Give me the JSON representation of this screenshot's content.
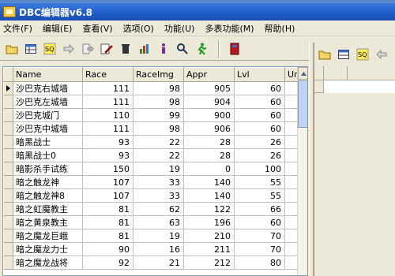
{
  "window": {
    "title": "DBC编辑器v6.8"
  },
  "menu": [
    "文件(F)",
    "编辑(E)",
    "查看(V)",
    "选项(O)",
    "功能(U)",
    "多表功能(M)",
    "帮助(H)"
  ],
  "toolbar_icons": [
    "open-folder-icon",
    "table-icon",
    "sq-icon",
    "arrow-right-icon",
    "export-icon",
    "edit-icon",
    "delete-icon",
    "chart-icon",
    "info-icon",
    "search-icon",
    "run-icon",
    "book-icon"
  ],
  "table": {
    "columns": [
      "Name",
      "Race",
      "RaceImg",
      "Appr",
      "Lvl",
      "Ur"
    ],
    "rows": [
      [
        "沙巴克右城墙",
        "111",
        "98",
        "905",
        "60"
      ],
      [
        "沙巴克左城墙",
        "111",
        "98",
        "904",
        "60"
      ],
      [
        "沙巴克城门",
        "110",
        "99",
        "900",
        "60"
      ],
      [
        "沙巴克中城墙",
        "111",
        "98",
        "906",
        "60"
      ],
      [
        "暗黑战士",
        "93",
        "22",
        "28",
        "26"
      ],
      [
        "暗黑战士0",
        "93",
        "22",
        "28",
        "26"
      ],
      [
        "暗影杀手试练",
        "150",
        "19",
        "0",
        "100"
      ],
      [
        "暗之触龙神",
        "107",
        "33",
        "140",
        "55"
      ],
      [
        "暗之触龙神8",
        "107",
        "33",
        "140",
        "55"
      ],
      [
        "暗之虹魔教主",
        "81",
        "62",
        "122",
        "66"
      ],
      [
        "暗之黄泉教主",
        "81",
        "63",
        "196",
        "60"
      ],
      [
        "暗之魔龙巨蛾",
        "81",
        "19",
        "210",
        "70"
      ],
      [
        "暗之魔龙力士",
        "90",
        "16",
        "211",
        "70"
      ],
      [
        "暗之魔龙战将",
        "92",
        "21",
        "212",
        "80"
      ]
    ]
  }
}
